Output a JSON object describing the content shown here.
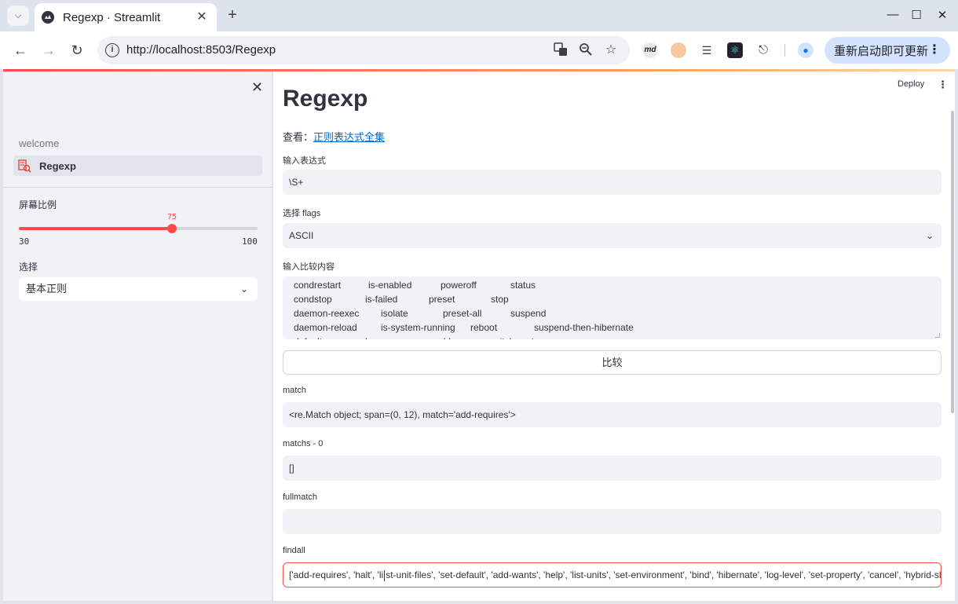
{
  "browser": {
    "tab_title": "Regexp · Streamlit",
    "url": "http://localhost:8503/Regexp",
    "update_button": "重新启动即可更新",
    "extension_md_label": "md"
  },
  "sidebar": {
    "nav_items": [
      {
        "label": "welcome"
      },
      {
        "label": "Regexp"
      }
    ],
    "slider": {
      "label": "屏幕比例",
      "value": 75,
      "min": 30,
      "max": 100,
      "value_text": "75",
      "min_text": "30",
      "max_text": "100"
    },
    "select": {
      "label": "选择",
      "value": "基本正则"
    }
  },
  "main": {
    "deploy_label": "Deploy",
    "title": "Regexp",
    "see_prefix": "查看：",
    "see_link": "正则表达式全集",
    "expr_label": "输入表达式",
    "expr_value": "\\S+",
    "flags_label": "选择 flags",
    "flags_value": "ASCII",
    "compare_label": "输入比较内容",
    "compare_lines": [
      [
        "condrestart",
        "is-enabled",
        "poweroff",
        "status"
      ],
      [
        "condstop",
        "is-failed",
        "preset",
        "stop"
      ],
      [
        "daemon-reexec",
        "isolate",
        "preset-all",
        "suspend"
      ],
      [
        "daemon-reload",
        "is-system-running",
        "reboot",
        "suspend-then-hibernate"
      ],
      [
        "default",
        "kexec",
        "reenable",
        "switch-root"
      ]
    ],
    "compare_button": "比较",
    "results": [
      {
        "label": "match",
        "value": "<re.Match object; span=(0, 12), match='add-requires'>"
      },
      {
        "label": "matchs - 0",
        "value": "[]"
      },
      {
        "label": "fullmatch",
        "value": ""
      },
      {
        "label": "findall",
        "value_before_cursor": "['add-requires', 'halt', 'li",
        "value_after_cursor": "st-unit-files', 'set-default', 'add-wants', 'help', 'list-units', 'set-environment', 'bind', 'hibernate', 'log-level', 'set-property', 'cancel', 'hybrid-sleep'"
      }
    ]
  },
  "colors": {
    "accent": "#ff4b4b",
    "link": "#0068c9",
    "field_bg": "#f0f2f6",
    "sidebar_bg": "#f0f2f6"
  }
}
